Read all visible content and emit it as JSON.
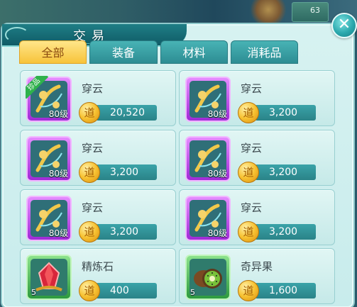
{
  "window": {
    "title": "交易",
    "close_label": "✕"
  },
  "scene": {
    "level": "63"
  },
  "tabs": [
    {
      "label": "全部",
      "active": true
    },
    {
      "label": "装备",
      "active": false
    },
    {
      "label": "材料",
      "active": false
    },
    {
      "label": "消耗品",
      "active": false
    }
  ],
  "items": [
    {
      "name": "穿云",
      "price": "20,520",
      "level": "80级",
      "rare_tag": "珍品",
      "frame": "purple",
      "icon": "bow-icon"
    },
    {
      "name": "穿云",
      "price": "3,200",
      "level": "80级",
      "rare_tag": "",
      "frame": "purple",
      "icon": "bow-icon"
    },
    {
      "name": "穿云",
      "price": "3,200",
      "level": "80级",
      "rare_tag": "",
      "frame": "purple",
      "icon": "bow-icon"
    },
    {
      "name": "穿云",
      "price": "3,200",
      "level": "80级",
      "rare_tag": "",
      "frame": "purple",
      "icon": "bow-icon"
    },
    {
      "name": "穿云",
      "price": "3,200",
      "level": "80级",
      "rare_tag": "",
      "frame": "purple",
      "icon": "bow-icon"
    },
    {
      "name": "穿云",
      "price": "3,200",
      "level": "80级",
      "rare_tag": "",
      "frame": "purple",
      "icon": "bow-icon"
    },
    {
      "name": "精炼石",
      "price": "400",
      "quantity": "5",
      "frame": "green",
      "icon": "refining-stone-icon"
    },
    {
      "name": "奇异果",
      "price": "1,600",
      "quantity": "5",
      "frame": "green",
      "icon": "kiwi-icon"
    }
  ],
  "currency": {
    "symbol": "道",
    "icon": "coin-icon"
  },
  "colors": {
    "panel": "#cdeeee",
    "tab_active": "#f7c33a",
    "tab_inactive": "#2d8d93",
    "price_bar": "#2f8e93"
  }
}
